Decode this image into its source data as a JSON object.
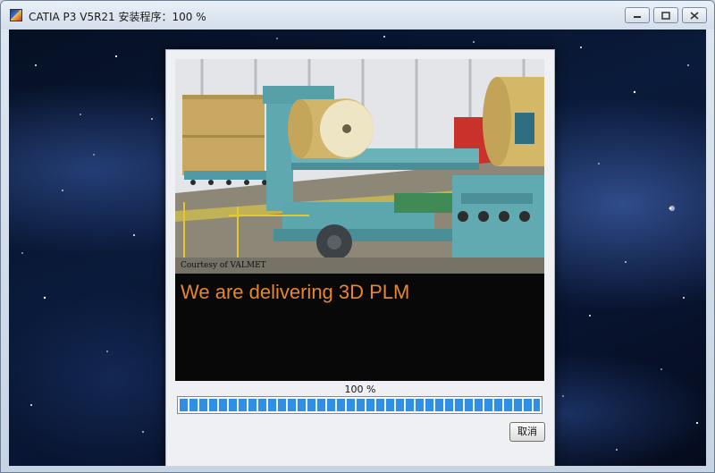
{
  "window": {
    "title": "CATIA P3 V5R21 安装程序：100 %",
    "controls": [
      "minimize-icon",
      "restore-icon",
      "close-icon"
    ]
  },
  "splash": {
    "courtesy": "Courtesy of VALMET",
    "tagline": "We are delivering 3D PLM",
    "tagline_color": "#e8862c"
  },
  "progress": {
    "label": "100 %",
    "value": 1.0,
    "fill_color": "#2f8fe6"
  },
  "buttons": {
    "cancel": "取消"
  }
}
